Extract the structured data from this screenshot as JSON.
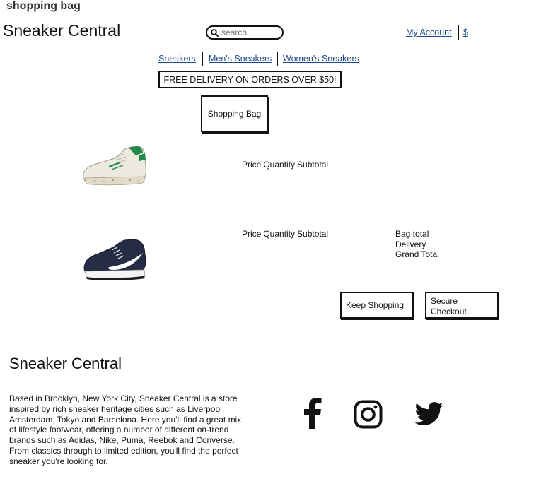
{
  "page_label": "shopping bag",
  "header": {
    "brand": "Sneaker Central",
    "search_placeholder": "search",
    "account_link": "My Account",
    "currency_link": "$"
  },
  "nav": {
    "items": [
      "Sneakers",
      "Men's Sneakers",
      "Women's Sneakers"
    ]
  },
  "banner": "FREE DELIVERY ON ORDERS OVER $50!",
  "bag": {
    "heading": "Shopping Bag",
    "columns": [
      "Price",
      "Quantity",
      "Subtotal"
    ],
    "items": [
      {
        "image_icon": "white-green-sneaker"
      },
      {
        "image_icon": "navy-swoosh-sneaker"
      }
    ],
    "totals": [
      "Bag total",
      "Delivery",
      "Grand Total"
    ],
    "keep_shopping": "Keep Shopping",
    "checkout": "Secure Checkout"
  },
  "footer": {
    "brand": "Sneaker Central",
    "about": "Based in Brooklyn, New York City, Sneaker Central is a store inspired by rich sneaker heritage cities such as Liverpool, Amsterdam, Tokyo and Barcelona. Here you'll find a great mix of lifestyle footwear, offering a number of different on-trend brands such as Adidas, Nike, Puma, Reebok and Converse. From classics through to limited edition, you'll find the perfect sneaker you're looking for.",
    "social": [
      "facebook-icon",
      "instagram-icon",
      "twitter-icon"
    ]
  },
  "colors": {
    "link": "#1d4a8c",
    "sneaker_green": "#1f8a4c",
    "sneaker_navy": "#252c44"
  }
}
